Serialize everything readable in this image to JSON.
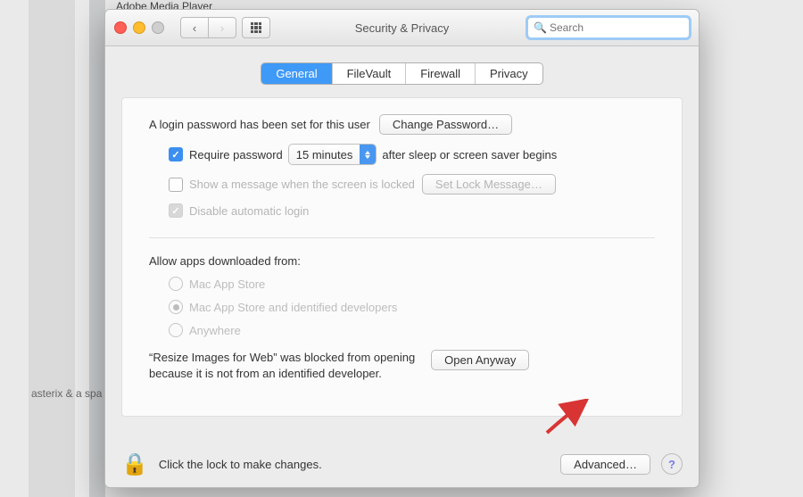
{
  "window_title": "Security & Privacy",
  "search": {
    "placeholder": "Search"
  },
  "tabs": {
    "general": "General",
    "filevault": "FileVault",
    "firewall": "Firewall",
    "privacy": "Privacy"
  },
  "password_section": {
    "login_set_text": "A login password has been set for this user",
    "change_password_btn": "Change Password…",
    "require_password_label": "Require password",
    "require_password_delay": "15 minutes",
    "require_password_after": "after sleep or screen saver begins",
    "show_message_label": "Show a message when the screen is locked",
    "set_lock_message_btn": "Set Lock Message…",
    "disable_auto_login_label": "Disable automatic login"
  },
  "allow_section": {
    "heading": "Allow apps downloaded from:",
    "options": {
      "mas": "Mac App Store",
      "mas_dev": "Mac App Store and identified developers",
      "anywhere": "Anywhere"
    },
    "blocked_text_line1": "“Resize Images for Web” was blocked from opening",
    "blocked_text_line2": "because it is not from an identified developer.",
    "open_anyway_btn": "Open Anyway"
  },
  "footer": {
    "lock_text": "Click the lock to make changes.",
    "advanced_btn": "Advanced…"
  },
  "bg": {
    "adobe": "Adobe Media Player",
    "asterix": "asterix & a spa"
  }
}
